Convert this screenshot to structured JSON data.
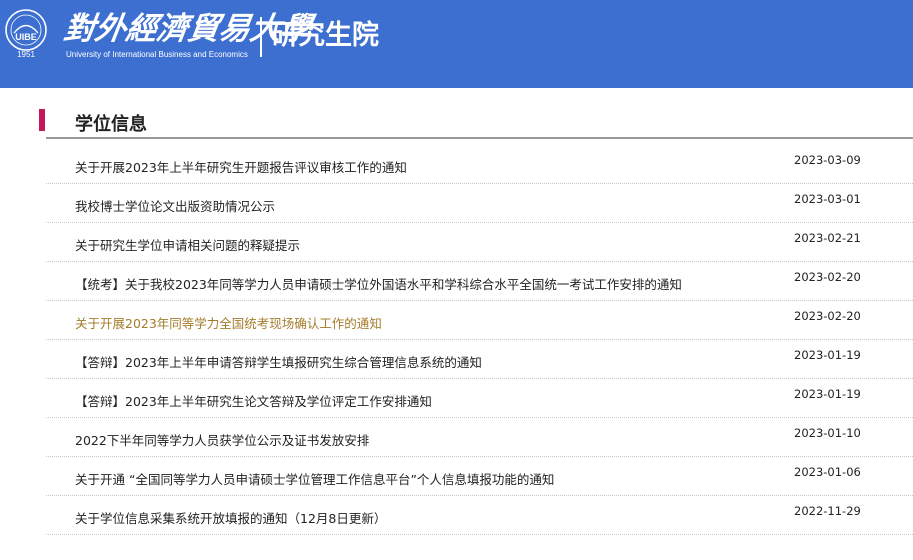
{
  "header": {
    "logo_year": "1951",
    "university_cn": "對外經濟貿易大學",
    "university_en": "University of International Business and Economics",
    "department": "研究生院",
    "bg_color": "#3d6fd1"
  },
  "section": {
    "title": "学位信息",
    "accent_color": "#c2185b"
  },
  "news": [
    {
      "title": "关于开展2023年上半年研究生开题报告评议审核工作的通知",
      "date": "2023-03-09"
    },
    {
      "title": "我校博士学位论文出版资助情况公示",
      "date": "2023-03-01"
    },
    {
      "title": "关于研究生学位申请相关问题的释疑提示",
      "date": "2023-02-21"
    },
    {
      "title": "【统考】关于我校2023年同等学力人员申请硕士学位外国语水平和学科综合水平全国统一考试工作安排的通知",
      "date": "2023-02-20"
    },
    {
      "title": "关于开展2023年同等学力全国统考现场确认工作的通知",
      "date": "2023-02-20"
    },
    {
      "title": "【答辩】2023年上半年申请答辩学生填报研究生综合管理信息系统的通知",
      "date": "2023-01-19"
    },
    {
      "title": "【答辩】2023年上半年研究生论文答辩及学位评定工作安排通知",
      "date": "2023-01-19"
    },
    {
      "title": "2022下半年同等学力人员获学位公示及证书发放安排",
      "date": "2023-01-10"
    },
    {
      "title": "关于开通 “全国同等学力人员申请硕士学位管理工作信息平台”个人信息填报功能的通知",
      "date": "2023-01-06"
    },
    {
      "title": "关于学位信息采集系统开放填报的通知（12月8日更新）",
      "date": "2022-11-29"
    }
  ],
  "highlight_color": "#a47d2c"
}
